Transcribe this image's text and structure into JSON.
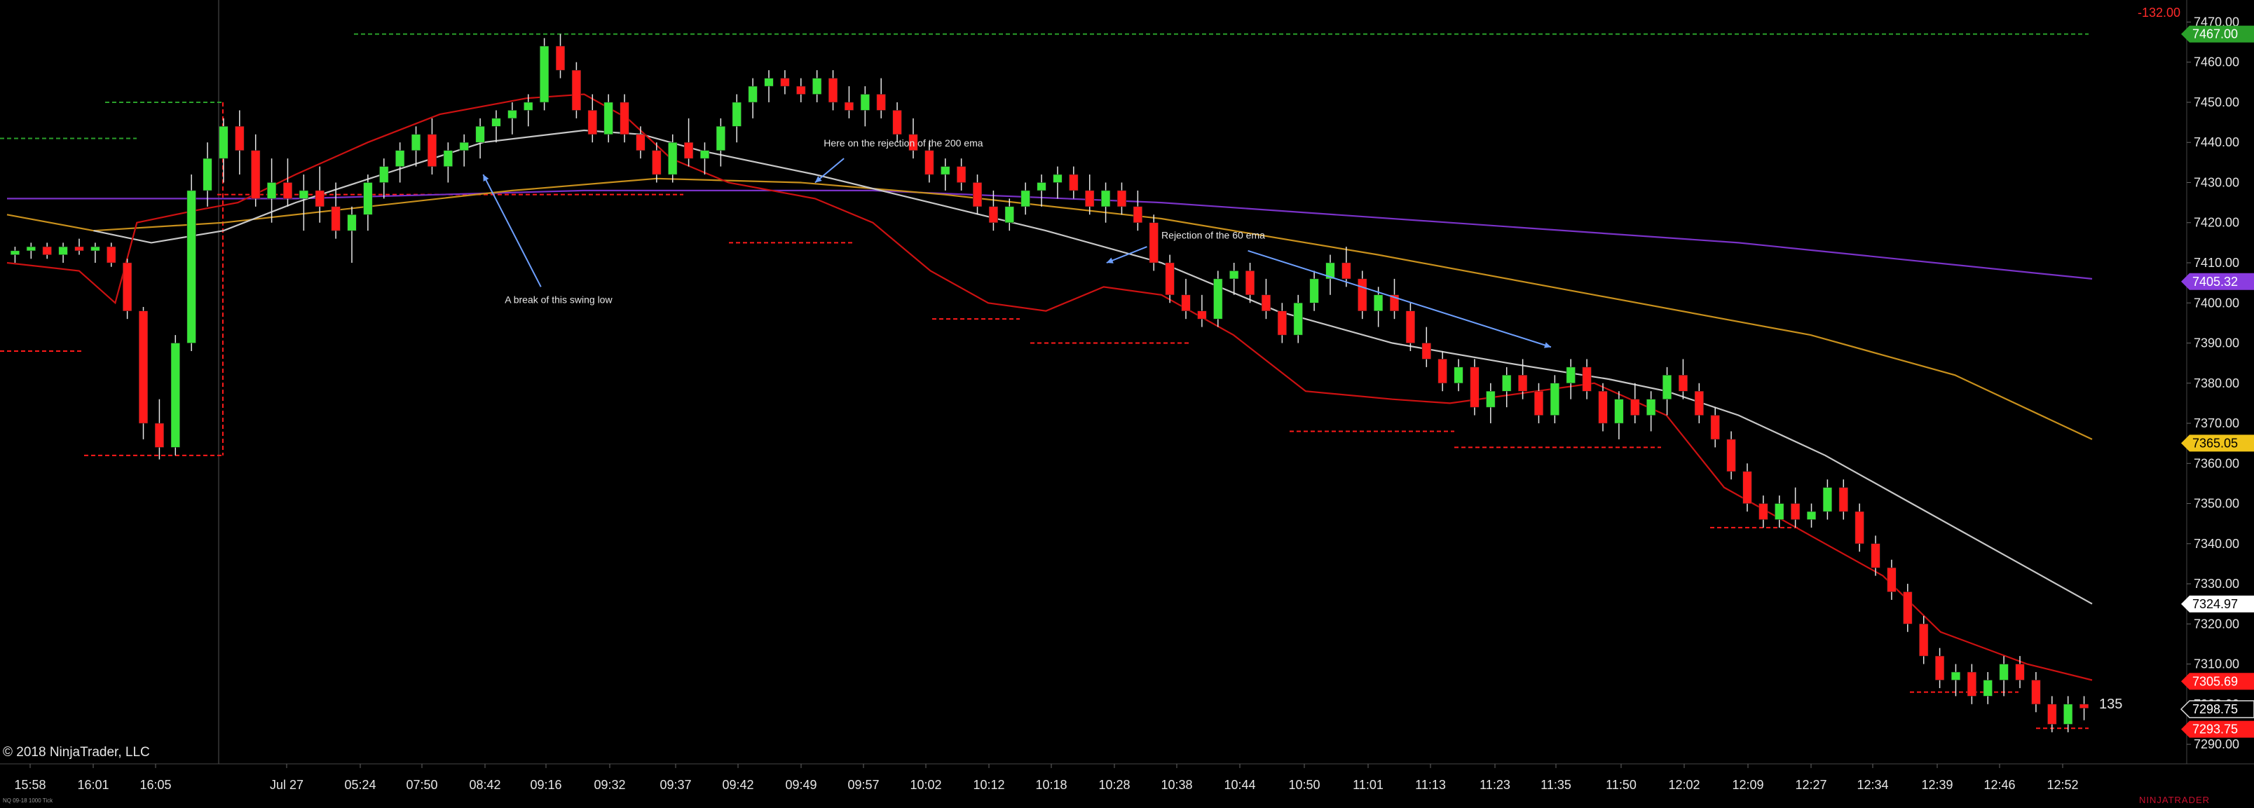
{
  "copyright": "© 2018 NinjaTrader, LLC",
  "instrument": "NQ 09-18 1000 Tick",
  "brand": "NINJATRADER",
  "pnl": "-132.00",
  "bar_count": "135",
  "colors": {
    "up": "#39e639",
    "down": "#ff1a1a",
    "ema_fast": "#cc1111",
    "ema_mid": "#c8c8c8",
    "ema_slow": "#c8901c",
    "ema_long": "#7a32c8",
    "annotation_arrow": "#6ea0ff"
  },
  "chart_data": {
    "type": "candlestick",
    "ylim": [
      7286,
      7472
    ],
    "yticks": [
      "7290.00",
      "7300.00",
      "7310.00",
      "7320.00",
      "7330.00",
      "7340.00",
      "7350.00",
      "7360.00",
      "7370.00",
      "7380.00",
      "7390.00",
      "7400.00",
      "7410.00",
      "7420.00",
      "7430.00",
      "7440.00",
      "7450.00",
      "7460.00",
      "7470.00"
    ],
    "xticks": [
      "15:58",
      "16:01",
      "16:05",
      "Jul 27",
      "05:24",
      "07:50",
      "08:42",
      "09:16",
      "09:32",
      "09:37",
      "09:42",
      "09:49",
      "09:57",
      "10:02",
      "10:12",
      "10:18",
      "10:28",
      "10:38",
      "10:44",
      "10:50",
      "11:01",
      "11:13",
      "11:23",
      "11:35",
      "11:50",
      "12:02",
      "12:09",
      "12:27",
      "12:34",
      "12:39",
      "12:46",
      "12:52"
    ],
    "price_markers": [
      {
        "label": "7467.00",
        "value": 7467.0,
        "color": "#2aa02a"
      },
      {
        "label": "7405.32",
        "value": 7405.32,
        "color": "#8a3ce0"
      },
      {
        "label": "7365.05",
        "value": 7365.05,
        "color": "#f0c419"
      },
      {
        "label": "7324.97",
        "value": 7324.97,
        "color": "#ffffff"
      },
      {
        "label": "7305.69",
        "value": 7305.69,
        "color": "#ff1a1a"
      },
      {
        "label": "7298.75",
        "value": 7298.75,
        "color": "#000000"
      },
      {
        "label": "7293.75",
        "value": 7293.75,
        "color": "#ff1a1a"
      }
    ],
    "annotations": [
      {
        "text": "Here on the rejection of the 200 ema",
        "time": 566,
        "price": 7439
      },
      {
        "text": "A break of this swing low",
        "time": 345,
        "price": 7400
      },
      {
        "text": "Rejection of the 60 ema",
        "time": 800,
        "price": 7416
      }
    ],
    "series": [
      {
        "name": "",
        "style": "ema_long",
        "points": [
          [
            0,
            7426
          ],
          [
            200,
            7426
          ],
          [
            400,
            7428
          ],
          [
            600,
            7428
          ],
          [
            800,
            7425
          ],
          [
            1000,
            7420
          ],
          [
            1200,
            7415
          ],
          [
            1445,
            7406
          ]
        ]
      },
      {
        "name": "",
        "style": "ema_slow",
        "points": [
          [
            0,
            7422
          ],
          [
            60,
            7418
          ],
          [
            150,
            7420
          ],
          [
            250,
            7424
          ],
          [
            350,
            7428
          ],
          [
            450,
            7431
          ],
          [
            550,
            7430
          ],
          [
            650,
            7427
          ],
          [
            800,
            7421
          ],
          [
            950,
            7412
          ],
          [
            1100,
            7402
          ],
          [
            1250,
            7392
          ],
          [
            1350,
            7382
          ],
          [
            1445,
            7366
          ]
        ]
      },
      {
        "name": "",
        "style": "ema_mid",
        "points": [
          [
            60,
            7418
          ],
          [
            100,
            7415
          ],
          [
            150,
            7418
          ],
          [
            200,
            7425
          ],
          [
            260,
            7432
          ],
          [
            330,
            7440
          ],
          [
            400,
            7443
          ],
          [
            440,
            7442
          ],
          [
            480,
            7438
          ],
          [
            560,
            7432
          ],
          [
            640,
            7425
          ],
          [
            720,
            7418
          ],
          [
            800,
            7410
          ],
          [
            880,
            7398
          ],
          [
            960,
            7390
          ],
          [
            1040,
            7385
          ],
          [
            1110,
            7381
          ],
          [
            1150,
            7378
          ],
          [
            1200,
            7372
          ],
          [
            1260,
            7362
          ],
          [
            1320,
            7350
          ],
          [
            1390,
            7336
          ],
          [
            1445,
            7325
          ]
        ]
      },
      {
        "name": "",
        "style": "ema_fast",
        "points": [
          [
            0,
            7410
          ],
          [
            50,
            7408
          ],
          [
            75,
            7400
          ],
          [
            90,
            7420
          ],
          [
            130,
            7423
          ],
          [
            160,
            7425
          ],
          [
            200,
            7432
          ],
          [
            250,
            7440
          ],
          [
            300,
            7447
          ],
          [
            360,
            7451
          ],
          [
            400,
            7452
          ],
          [
            430,
            7446
          ],
          [
            460,
            7436
          ],
          [
            500,
            7430
          ],
          [
            560,
            7426
          ],
          [
            600,
            7420
          ],
          [
            640,
            7408
          ],
          [
            680,
            7400
          ],
          [
            720,
            7398
          ],
          [
            760,
            7404
          ],
          [
            800,
            7402
          ],
          [
            850,
            7392
          ],
          [
            900,
            7378
          ],
          [
            960,
            7376
          ],
          [
            1000,
            7375
          ],
          [
            1060,
            7378
          ],
          [
            1100,
            7380
          ],
          [
            1150,
            7372
          ],
          [
            1190,
            7354
          ],
          [
            1250,
            7342
          ],
          [
            1300,
            7332
          ],
          [
            1340,
            7318
          ],
          [
            1400,
            7310
          ],
          [
            1445,
            7306
          ]
        ]
      }
    ],
    "candles": [
      [
        7412,
        7414,
        7410,
        7413
      ],
      [
        7413,
        7415,
        7411,
        7414
      ],
      [
        7414,
        7415,
        7411,
        7412
      ],
      [
        7412,
        7415,
        7410,
        7414
      ],
      [
        7414,
        7416,
        7412,
        7413
      ],
      [
        7413,
        7415,
        7410,
        7414
      ],
      [
        7414,
        7415,
        7409,
        7410
      ],
      [
        7410,
        7411,
        7396,
        7398
      ],
      [
        7398,
        7399,
        7366,
        7370
      ],
      [
        7370,
        7376,
        7361,
        7364
      ],
      [
        7364,
        7392,
        7362,
        7390
      ],
      [
        7390,
        7432,
        7388,
        7428
      ],
      [
        7428,
        7440,
        7424,
        7436
      ],
      [
        7436,
        7446,
        7430,
        7444
      ],
      [
        7444,
        7448,
        7432,
        7438
      ],
      [
        7438,
        7442,
        7424,
        7426
      ],
      [
        7426,
        7436,
        7420,
        7430
      ],
      [
        7430,
        7436,
        7424,
        7426
      ],
      [
        7426,
        7432,
        7418,
        7428
      ],
      [
        7428,
        7434,
        7420,
        7424
      ],
      [
        7424,
        7430,
        7416,
        7418
      ],
      [
        7418,
        7424,
        7410,
        7422
      ],
      [
        7422,
        7432,
        7418,
        7430
      ],
      [
        7430,
        7436,
        7426,
        7434
      ],
      [
        7434,
        7440,
        7430,
        7438
      ],
      [
        7438,
        7444,
        7434,
        7442
      ],
      [
        7442,
        7446,
        7432,
        7434
      ],
      [
        7434,
        7440,
        7430,
        7438
      ],
      [
        7438,
        7442,
        7434,
        7440
      ],
      [
        7440,
        7446,
        7436,
        7444
      ],
      [
        7444,
        7448,
        7440,
        7446
      ],
      [
        7446,
        7450,
        7442,
        7448
      ],
      [
        7448,
        7452,
        7444,
        7450
      ],
      [
        7450,
        7466,
        7448,
        7464
      ],
      [
        7464,
        7467,
        7456,
        7458
      ],
      [
        7458,
        7460,
        7446,
        7448
      ],
      [
        7448,
        7452,
        7440,
        7442
      ],
      [
        7442,
        7452,
        7440,
        7450
      ],
      [
        7450,
        7452,
        7440,
        7442
      ],
      [
        7442,
        7444,
        7436,
        7438
      ],
      [
        7438,
        7440,
        7430,
        7432
      ],
      [
        7432,
        7442,
        7430,
        7440
      ],
      [
        7440,
        7446,
        7434,
        7436
      ],
      [
        7436,
        7440,
        7432,
        7438
      ],
      [
        7438,
        7446,
        7434,
        7444
      ],
      [
        7444,
        7452,
        7440,
        7450
      ],
      [
        7450,
        7456,
        7446,
        7454
      ],
      [
        7454,
        7458,
        7450,
        7456
      ],
      [
        7456,
        7458,
        7452,
        7454
      ],
      [
        7454,
        7456,
        7450,
        7452
      ],
      [
        7452,
        7458,
        7450,
        7456
      ],
      [
        7456,
        7458,
        7448,
        7450
      ],
      [
        7450,
        7454,
        7446,
        7448
      ],
      [
        7448,
        7454,
        7444,
        7452
      ],
      [
        7452,
        7456,
        7446,
        7448
      ],
      [
        7448,
        7450,
        7440,
        7442
      ],
      [
        7442,
        7446,
        7436,
        7438
      ],
      [
        7438,
        7440,
        7430,
        7432
      ],
      [
        7432,
        7436,
        7428,
        7434
      ],
      [
        7434,
        7436,
        7428,
        7430
      ],
      [
        7430,
        7432,
        7422,
        7424
      ],
      [
        7424,
        7428,
        7418,
        7420
      ],
      [
        7420,
        7426,
        7418,
        7424
      ],
      [
        7424,
        7430,
        7422,
        7428
      ],
      [
        7428,
        7432,
        7424,
        7430
      ],
      [
        7430,
        7434,
        7426,
        7432
      ],
      [
        7432,
        7434,
        7426,
        7428
      ],
      [
        7428,
        7432,
        7422,
        7424
      ],
      [
        7424,
        7430,
        7420,
        7428
      ],
      [
        7428,
        7430,
        7422,
        7424
      ],
      [
        7424,
        7428,
        7418,
        7420
      ],
      [
        7420,
        7422,
        7408,
        7410
      ],
      [
        7410,
        7412,
        7400,
        7402
      ],
      [
        7402,
        7406,
        7396,
        7398
      ],
      [
        7398,
        7402,
        7394,
        7396
      ],
      [
        7396,
        7408,
        7394,
        7406
      ],
      [
        7406,
        7410,
        7402,
        7408
      ],
      [
        7408,
        7410,
        7400,
        7402
      ],
      [
        7402,
        7406,
        7396,
        7398
      ],
      [
        7398,
        7400,
        7390,
        7392
      ],
      [
        7392,
        7402,
        7390,
        7400
      ],
      [
        7400,
        7408,
        7398,
        7406
      ],
      [
        7406,
        7412,
        7402,
        7410
      ],
      [
        7410,
        7414,
        7404,
        7406
      ],
      [
        7406,
        7408,
        7396,
        7398
      ],
      [
        7398,
        7404,
        7394,
        7402
      ],
      [
        7402,
        7406,
        7396,
        7398
      ],
      [
        7398,
        7400,
        7388,
        7390
      ],
      [
        7390,
        7394,
        7384,
        7386
      ],
      [
        7386,
        7388,
        7378,
        7380
      ],
      [
        7380,
        7386,
        7378,
        7384
      ],
      [
        7384,
        7386,
        7372,
        7374
      ],
      [
        7374,
        7380,
        7370,
        7378
      ],
      [
        7378,
        7384,
        7374,
        7382
      ],
      [
        7382,
        7386,
        7376,
        7378
      ],
      [
        7378,
        7380,
        7370,
        7372
      ],
      [
        7372,
        7382,
        7370,
        7380
      ],
      [
        7380,
        7386,
        7376,
        7384
      ],
      [
        7384,
        7386,
        7376,
        7378
      ],
      [
        7378,
        7380,
        7368,
        7370
      ],
      [
        7370,
        7378,
        7366,
        7376
      ],
      [
        7376,
        7380,
        7370,
        7372
      ],
      [
        7372,
        7378,
        7368,
        7376
      ],
      [
        7376,
        7384,
        7372,
        7382
      ],
      [
        7382,
        7386,
        7376,
        7378
      ],
      [
        7378,
        7380,
        7370,
        7372
      ],
      [
        7372,
        7374,
        7364,
        7366
      ],
      [
        7366,
        7368,
        7356,
        7358
      ],
      [
        7358,
        7360,
        7348,
        7350
      ],
      [
        7350,
        7352,
        7344,
        7346
      ],
      [
        7346,
        7352,
        7344,
        7350
      ],
      [
        7350,
        7354,
        7344,
        7346
      ],
      [
        7346,
        7350,
        7344,
        7348
      ],
      [
        7348,
        7356,
        7346,
        7354
      ],
      [
        7354,
        7356,
        7346,
        7348
      ],
      [
        7348,
        7350,
        7338,
        7340
      ],
      [
        7340,
        7342,
        7332,
        7334
      ],
      [
        7334,
        7336,
        7326,
        7328
      ],
      [
        7328,
        7330,
        7318,
        7320
      ],
      [
        7320,
        7322,
        7310,
        7312
      ],
      [
        7312,
        7314,
        7304,
        7306
      ],
      [
        7306,
        7310,
        7302,
        7308
      ],
      [
        7308,
        7310,
        7300,
        7302
      ],
      [
        7302,
        7308,
        7300,
        7306
      ],
      [
        7306,
        7312,
        7302,
        7310
      ],
      [
        7310,
        7312,
        7304,
        7306
      ],
      [
        7306,
        7308,
        7298,
        7300
      ],
      [
        7300,
        7302,
        7293,
        7295
      ],
      [
        7295,
        7302,
        7293,
        7300
      ],
      [
        7300,
        7302,
        7296,
        7299
      ]
    ]
  }
}
